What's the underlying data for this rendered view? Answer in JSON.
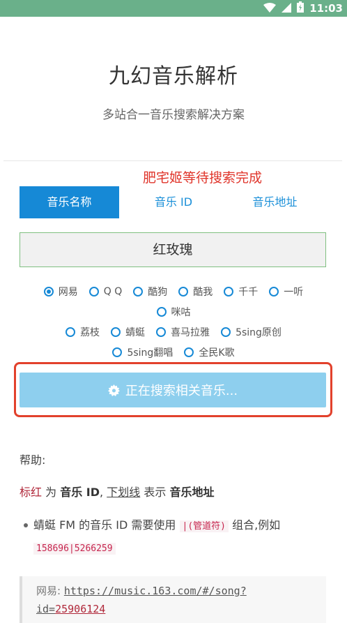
{
  "status_bar": {
    "time": "11:03",
    "color": "#6ab08a"
  },
  "app": {
    "title": "九幻音乐解析",
    "subtitle": "多站合一音乐搜索解决方案"
  },
  "status_message": "肥宅姬等待搜索完成",
  "tabs": [
    {
      "label": "音乐名称",
      "active": true
    },
    {
      "label": "音乐 ID",
      "active": false
    },
    {
      "label": "音乐地址",
      "active": false
    }
  ],
  "search": {
    "value": "红玫瑰"
  },
  "sources": {
    "row1": [
      "网易",
      "Q Q",
      "酷狗",
      "酷我",
      "千千",
      "一听"
    ],
    "row2": [
      "咪咕"
    ],
    "row3": [
      "荔枝",
      "蜻蜓",
      "喜马拉雅",
      "5sing原创"
    ],
    "row4": [
      "5sing翻唱",
      "全民K歌"
    ],
    "selected": "网易"
  },
  "search_button": {
    "label": "正在搜索相关音乐..."
  },
  "help": {
    "label": "帮助:",
    "red_label": "标红",
    "for_text": "为",
    "music_id": "音乐 ID",
    "comma": ",",
    "underline_label": "下划线",
    "means_text": "表示",
    "music_url": "音乐地址",
    "bullet_prefix": "蜻蜓 FM 的音乐 ID 需要使用",
    "pipe_code": "|(管道符)",
    "bullet_suffix": "组合,例如",
    "example_code": "158696|5266259",
    "quote_label": "网易:",
    "quote_url": "https://music.163.com/#/song?",
    "quote_id_prefix": "id=",
    "quote_id": "25906124"
  },
  "colors": {
    "accent": "#1689d6",
    "button_disabled": "#8ecfee",
    "highlight_red": "#e2412c",
    "status_red": "#e0352b"
  }
}
